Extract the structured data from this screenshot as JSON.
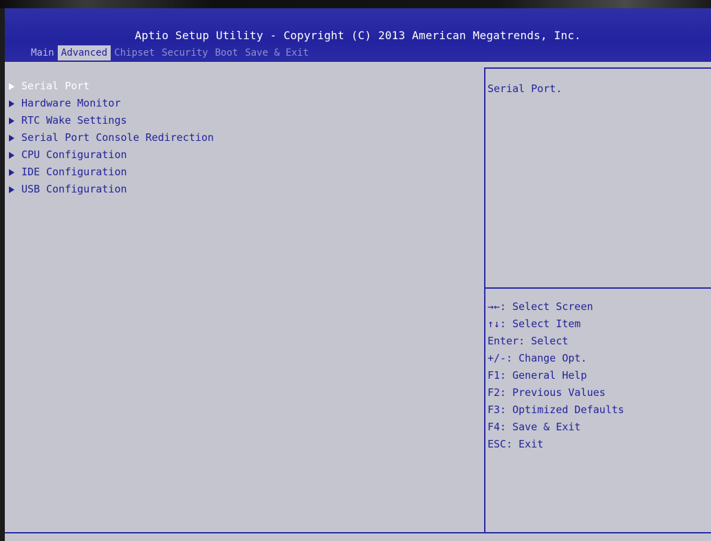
{
  "header": {
    "title": "Aptio Setup Utility - Copyright (C) 2013 American Megatrends, Inc."
  },
  "tabs": [
    {
      "label": "Main",
      "active": false
    },
    {
      "label": "Advanced",
      "active": true
    },
    {
      "label": "Chipset",
      "active": false
    },
    {
      "label": "Security",
      "active": false
    },
    {
      "label": "Boot",
      "active": false
    },
    {
      "label": "Save & Exit",
      "active": false
    }
  ],
  "menu": {
    "items": [
      {
        "label": "Serial Port",
        "selected": true
      },
      {
        "label": "Hardware Monitor",
        "selected": false
      },
      {
        "label": "RTC Wake Settings",
        "selected": false
      },
      {
        "label": "Serial Port Console Redirection",
        "selected": false
      },
      {
        "label": "CPU Configuration",
        "selected": false
      },
      {
        "label": "IDE Configuration",
        "selected": false
      },
      {
        "label": "USB Configuration",
        "selected": false
      }
    ]
  },
  "help": {
    "text": "Serial Port."
  },
  "keys": [
    "→←: Select Screen",
    "↑↓: Select Item",
    "Enter: Select",
    "+/-: Change Opt.",
    "F1: General Help",
    "F2: Previous Values",
    "F3: Optimized Defaults",
    "F4: Save & Exit",
    "ESC: Exit"
  ],
  "colors": {
    "header_bg": "#2323a0",
    "body_bg": "#c4c5ce",
    "text_blue": "#23239b",
    "selected_text": "#ffffff"
  }
}
